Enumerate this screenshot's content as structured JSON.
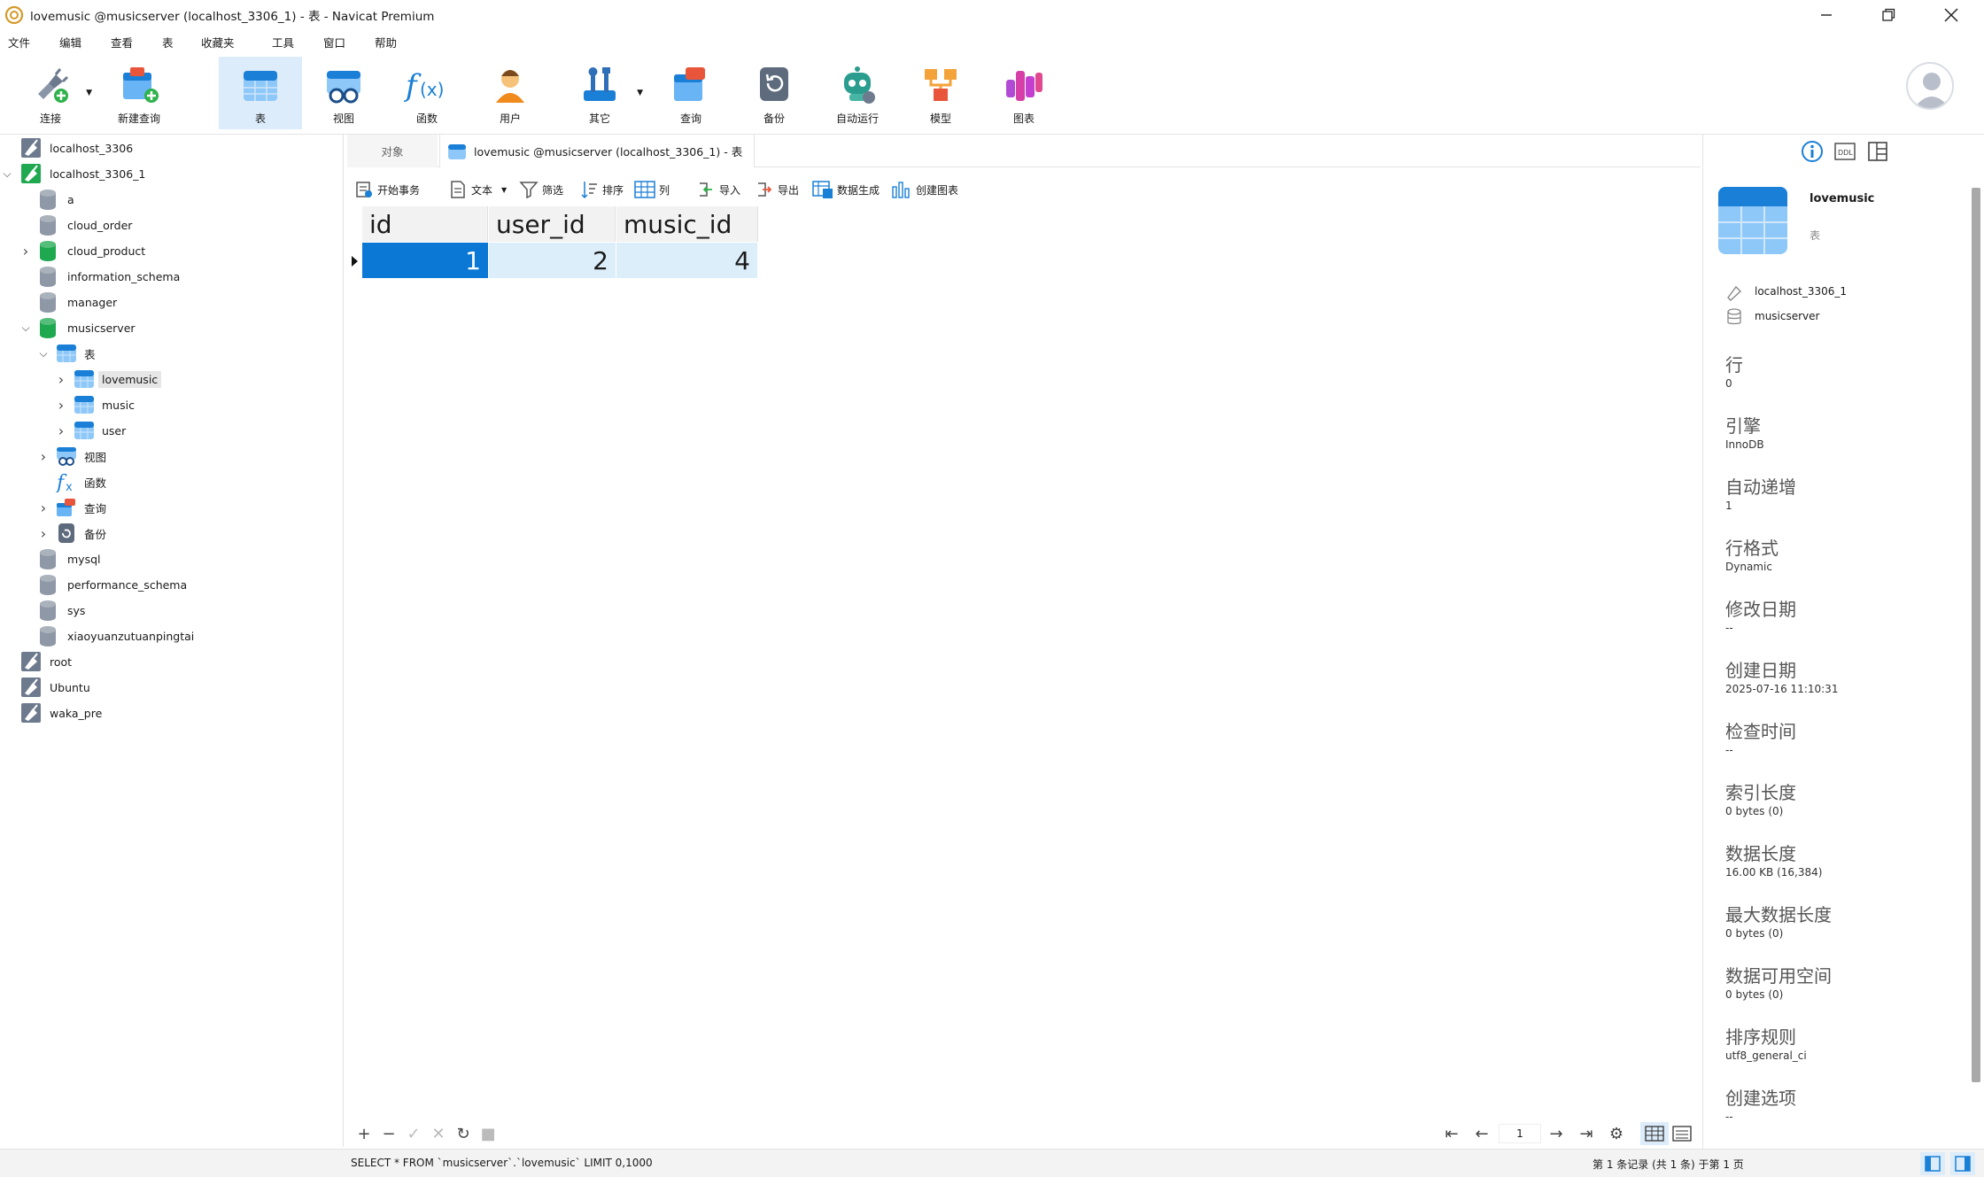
{
  "window": {
    "title": "lovemusic @musicserver (localhost_3306_1) - 表 - Navicat Premium"
  },
  "menu": [
    "文件",
    "编辑",
    "查看",
    "表",
    "收藏夹",
    "工具",
    "窗口",
    "帮助"
  ],
  "toolbar": [
    {
      "label": "连接",
      "icon": "plug-icon"
    },
    {
      "label": "新建查询",
      "icon": "new-query-icon"
    },
    {
      "label": "表",
      "icon": "table-icon",
      "active": true
    },
    {
      "label": "视图",
      "icon": "view-icon"
    },
    {
      "label": "函数",
      "icon": "function-icon"
    },
    {
      "label": "用户",
      "icon": "user-icon"
    },
    {
      "label": "其它",
      "icon": "tools-icon"
    },
    {
      "label": "查询",
      "icon": "query-icon"
    },
    {
      "label": "备份",
      "icon": "backup-icon"
    },
    {
      "label": "自动运行",
      "icon": "robot-icon"
    },
    {
      "label": "模型",
      "icon": "model-icon"
    },
    {
      "label": "图表",
      "icon": "chart-icon"
    }
  ],
  "tree": [
    {
      "label": "localhost_3306",
      "level": 0,
      "type": "conn"
    },
    {
      "label": "localhost_3306_1",
      "level": 0,
      "type": "conn-active",
      "expanded": true
    },
    {
      "label": "a",
      "level": 1,
      "type": "db"
    },
    {
      "label": "cloud_order",
      "level": 1,
      "type": "db"
    },
    {
      "label": "cloud_product",
      "level": 1,
      "type": "db-active",
      "collapsed": true
    },
    {
      "label": "information_schema",
      "level": 1,
      "type": "db"
    },
    {
      "label": "manager",
      "level": 1,
      "type": "db"
    },
    {
      "label": "musicserver",
      "level": 1,
      "type": "db-active",
      "expanded": true
    },
    {
      "label": "表",
      "level": 2,
      "type": "tables",
      "expanded": true
    },
    {
      "label": "lovemusic",
      "level": 3,
      "type": "table",
      "collapsed": true,
      "selected": true
    },
    {
      "label": "music",
      "level": 3,
      "type": "table",
      "collapsed": true
    },
    {
      "label": "user",
      "level": 3,
      "type": "table",
      "collapsed": true
    },
    {
      "label": "视图",
      "level": 2,
      "type": "views",
      "collapsed": true
    },
    {
      "label": "函数",
      "level": 2,
      "type": "functions"
    },
    {
      "label": "查询",
      "level": 2,
      "type": "queries",
      "collapsed": true
    },
    {
      "label": "备份",
      "level": 2,
      "type": "backups",
      "collapsed": true
    },
    {
      "label": "mysql",
      "level": 1,
      "type": "db"
    },
    {
      "label": "performance_schema",
      "level": 1,
      "type": "db"
    },
    {
      "label": "sys",
      "level": 1,
      "type": "db"
    },
    {
      "label": "xiaoyuanzutuanpingtai",
      "level": 1,
      "type": "db"
    },
    {
      "label": "root",
      "level": 0,
      "type": "conn"
    },
    {
      "label": "Ubuntu",
      "level": 0,
      "type": "conn"
    },
    {
      "label": "waka_pre",
      "level": 0,
      "type": "conn"
    }
  ],
  "tabs": {
    "objects": "对象",
    "active": "lovemusic @musicserver (localhost_3306_1) - 表"
  },
  "data_toolbar": {
    "begin": "开始事务",
    "text": "文本",
    "filter": "筛选",
    "sort": "排序",
    "columns": "列",
    "import": "导入",
    "export": "导出",
    "generate": "数据生成",
    "create_chart": "创建图表"
  },
  "grid": {
    "columns": [
      "id",
      "user_id",
      "music_id"
    ],
    "rows": [
      [
        "1",
        "2",
        "4"
      ]
    ]
  },
  "nav": {
    "page": "1"
  },
  "status": {
    "sql": "SELECT * FROM `musicserver`.`lovemusic` LIMIT 0,1000",
    "record": "第 1 条记录 (共 1 条) 于第 1 页"
  },
  "panel": {
    "name": "lovemusic",
    "type": "表",
    "connection": "localhost_3306_1",
    "database": "musicserver",
    "props": [
      {
        "name": "行",
        "value": "0"
      },
      {
        "name": "引擎",
        "value": "InnoDB"
      },
      {
        "name": "自动递增",
        "value": "1"
      },
      {
        "name": "行格式",
        "value": "Dynamic"
      },
      {
        "name": "修改日期",
        "value": "--"
      },
      {
        "name": "创建日期",
        "value": "2025-07-16 11:10:31"
      },
      {
        "name": "检查时间",
        "value": "--"
      },
      {
        "name": "索引长度",
        "value": "0 bytes (0)"
      },
      {
        "name": "数据长度",
        "value": "16.00 KB (16,384)"
      },
      {
        "name": "最大数据长度",
        "value": "0 bytes (0)"
      },
      {
        "name": "数据可用空间",
        "value": "0 bytes (0)"
      },
      {
        "name": "排序规则",
        "value": "utf8_general_ci"
      },
      {
        "name": "创建选项",
        "value": "--"
      }
    ]
  },
  "colors": {
    "accent": "#0a78d4",
    "selection_light": "#ddeefb",
    "db_active": "#1ea84f"
  }
}
